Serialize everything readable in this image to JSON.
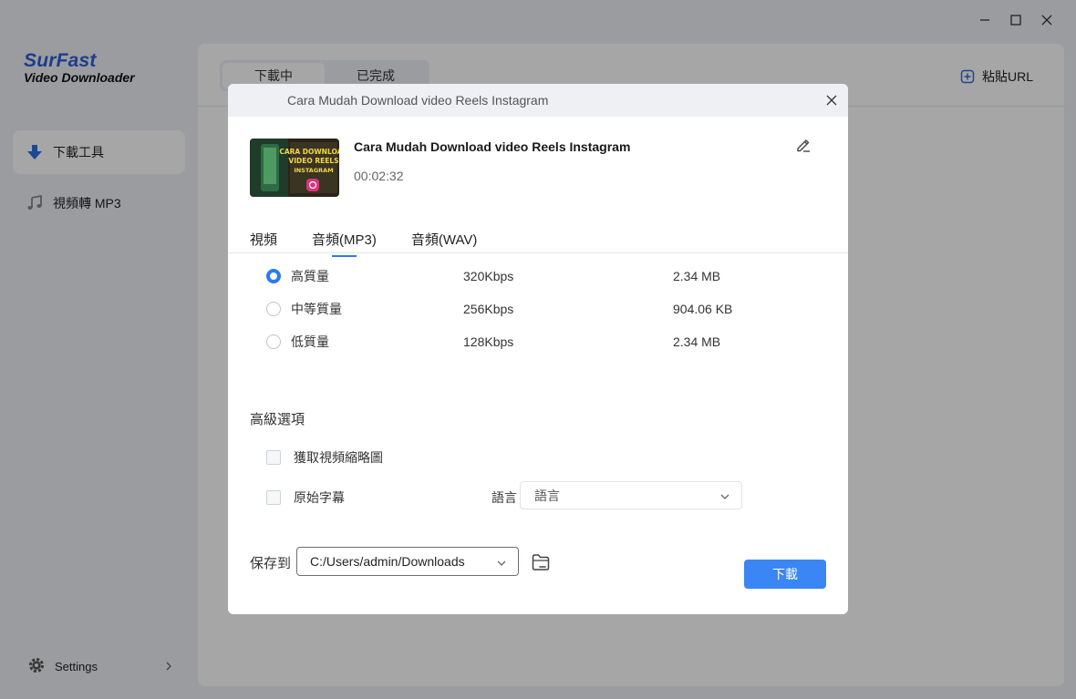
{
  "app": {
    "logo_line1": "SurFast",
    "logo_line2": "Video Downloader"
  },
  "sidebar": {
    "items": [
      {
        "label": "下載工具",
        "icon": "download-arrow-icon",
        "active": true
      },
      {
        "label": "視頻轉 MP3",
        "icon": "music-note-icon",
        "active": false
      }
    ],
    "settings_label": "Settings"
  },
  "main": {
    "tabs": [
      {
        "label": "下載中",
        "active": true
      },
      {
        "label": "已完成",
        "active": false
      }
    ],
    "paste_url_label": "粘貼URL"
  },
  "dialog": {
    "header_title": "Cara Mudah Download video Reels Instagram",
    "video": {
      "title": "Cara Mudah Download video Reels Instagram",
      "duration": "00:02:32",
      "thumbnail_text": "CARA DOWNLOAD VIDEO REELS INSTAGRAM"
    },
    "format_tabs": [
      {
        "label": "視頻",
        "active": false
      },
      {
        "label": "音頻(MP3)",
        "active": true
      },
      {
        "label": "音頻(WAV)",
        "active": false
      }
    ],
    "qualities": [
      {
        "name": "高質量",
        "bitrate": "320Kbps",
        "size": "2.34 MB",
        "selected": true
      },
      {
        "name": "中等質量",
        "bitrate": "256Kbps",
        "size": "904.06 KB",
        "selected": false
      },
      {
        "name": "低質量",
        "bitrate": "128Kbps",
        "size": "2.34 MB",
        "selected": false
      }
    ],
    "advanced_title": "高級選項",
    "options": {
      "thumbnail_label": "獲取視頻縮略圖",
      "subtitle_label": "原始字幕",
      "language_label": "語言",
      "language_value": "語言"
    },
    "save_to_label": "保存到",
    "save_path": "C:/Users/admin/Downloads",
    "download_label": "下載"
  },
  "colors": {
    "accent": "#2b7bef",
    "button": "#3a86f5",
    "logo_blue": "#2b5fd9"
  }
}
